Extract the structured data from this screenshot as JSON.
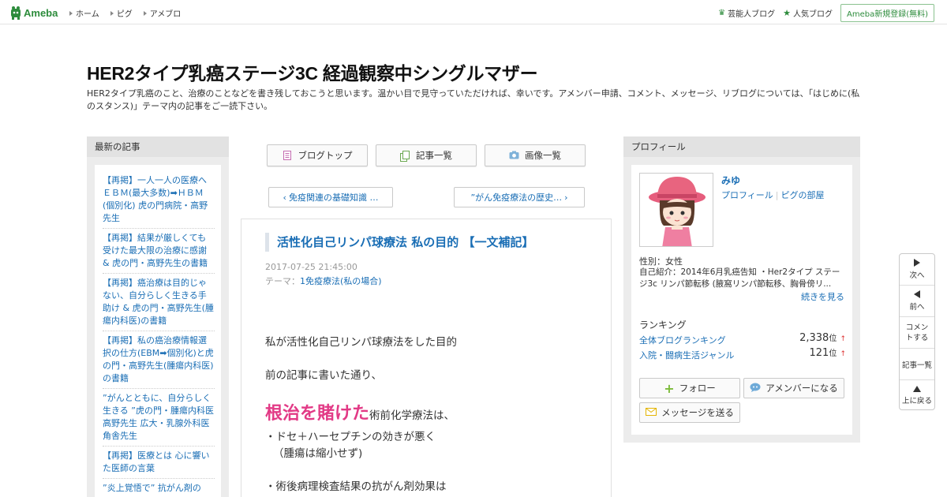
{
  "topbar": {
    "brand": "Ameba",
    "nav": [
      "ホーム",
      "ピグ",
      "アメブロ"
    ],
    "right_links": [
      "芸能人ブログ",
      "人気ブログ"
    ],
    "signup": "Ameba新規登録(無料)"
  },
  "header": {
    "title": "HER2タイプ乳癌ステージ3C 経過観察中シングルマザー",
    "description": "HER2タイプ乳癌のこと、治療のことなどを書き残しておこうと思います。温かい目で見守っていただければ、幸いです。アメンバー申請、コメント、メッセージ、リブログについては、「はじめに(私のスタンス)」テーマ内の記事をご一読下さい。"
  },
  "recent": {
    "heading": "最新の記事",
    "items": [
      "【再掲】一人一人の医療へ ＥＢＭ(最大多数)➡ＨＢＭ(個別化) 虎の門病院・高野先生",
      "【再掲】結果が厳しくても受けた最大限の治療に感謝 & 虎の門・高野先生の書籍",
      "【再掲】癌治療は目的じゃない、自分らしく生きる手助け & 虎の門・高野先生(腫瘍内科医)の書籍",
      "【再掲】私の癌治療情報選択の仕方(EBM➡個別化)と虎の門・高野先生(腫瘍内科医)の書籍",
      "”がんとともに、自分らしく生きる ”虎の門・腫瘍内科医 高野先生 広大・乳腺外科医 角舎先生",
      "【再掲】医療とは 心に響いた医師の言葉",
      "”炎上覚悟で” 抗がん剤の"
    ]
  },
  "center": {
    "btn_top": "ブログトップ",
    "btn_list": "記事一覧",
    "btn_images": "画像一覧",
    "prev": "免疫関連の基礎知識 …",
    "next": "”がん免疫療法の歴史…"
  },
  "article": {
    "title": "活性化自己リンパ球療法 私の目的 【一文補記】",
    "date": "2017-07-25 21:45:00",
    "theme_label": "テーマ：",
    "theme": "1免疫療法(私の場合)",
    "line1": "私が活性化自己リンパ球療法をした目的",
    "line2": "前の記事に書いた通り、",
    "highlight": "根治を賭けた",
    "line3_rest": "術前化学療法は、",
    "line4": "・ドセ＋ハーセプチンの効きが悪く",
    "line5": "（腫瘍は縮小せず)",
    "line6": "・術後病理検査結果の抗がん剤効果は"
  },
  "profile": {
    "heading": "プロフィール",
    "name": "みゆ",
    "link_profile": "プロフィール",
    "link_pigg": "ピグの部屋",
    "gender": "性別：女性",
    "intro": "自己紹介：2014年6月乳癌告知 ・Her2タイプ ステージ3c リンパ節転移 (腋窩リンパ節転移、胸骨傍リ...",
    "more": "続きを見る",
    "ranking_heading": "ランキング",
    "ranks": [
      {
        "label": "全体ブログランキング",
        "value": "2,338",
        "unit": "位",
        "arrow": "↑"
      },
      {
        "label": "入院・闘病生活ジャンル",
        "value": "121",
        "unit": "位",
        "arrow": "↑"
      }
    ],
    "btn_follow": "フォロー",
    "btn_amember": "アメンバーになる",
    "btn_message": "メッセージを送る"
  },
  "sidenav": {
    "next": "次へ",
    "prev": "前へ",
    "comment": "コメントする",
    "list": "記事一覧",
    "top": "上に戻る"
  }
}
